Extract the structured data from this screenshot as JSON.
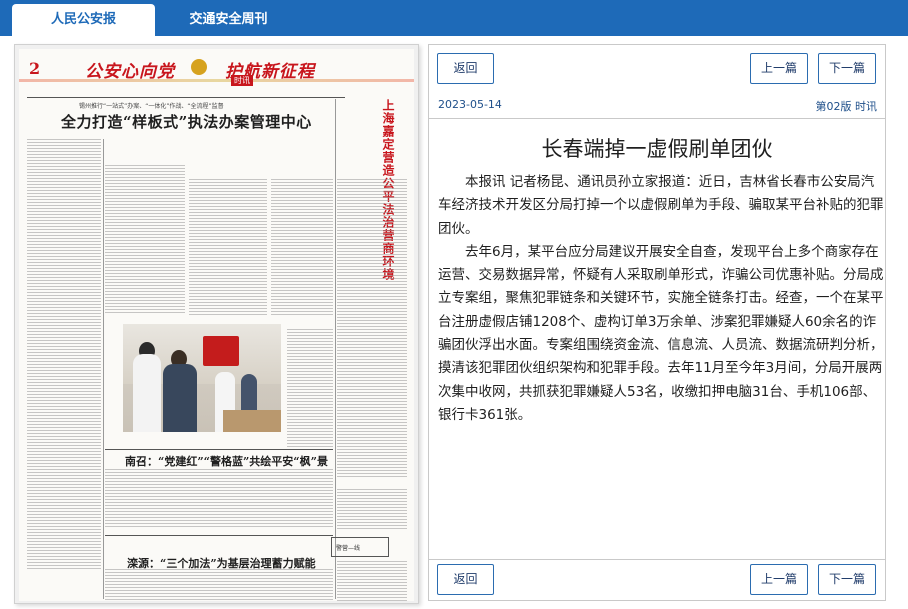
{
  "tabs": [
    {
      "label": "人民公安报",
      "active": true
    },
    {
      "label": "交通安全周刊",
      "active": false
    }
  ],
  "newspaper": {
    "page_number": "2",
    "slogan_left": "公安心向党",
    "slogan_right": "护航新征程",
    "section": "时讯",
    "headline_kicker": "锡州推行“一站式”办案、“一体化”作战、“全流程”监督",
    "headline": "全力打造“样板式”执法办案管理中心",
    "vertical_headline": "上海嘉定营造公平法治营商环境",
    "subhead_1": "南召：“党建红”“警格蓝”共绘平安“枫”景",
    "subhead_2": "滦源：“三个加法”为基层治理蓄力赋能",
    "box_label": "警营—线"
  },
  "article": {
    "back_label": "返回",
    "prev_label": "上一篇",
    "next_label": "下一篇",
    "date": "2023-05-14",
    "edition": "第02版 时讯",
    "title": "长春端掉一虚假刷单团伙",
    "paragraphs": [
      "本报讯 记者杨昆、通讯员孙立家报道：近日，吉林省长春市公安局汽车经济技术开发区分局打掉一个以虚假刷单为手段、骗取某平台补贴的犯罪团伙。",
      "去年6月，某平台应分局建议开展安全自查，发现平台上多个商家存在运营、交易数据异常，怀疑有人采取刷单形式，诈骗公司优惠补贴。分局成立专案组，聚焦犯罪链条和关键环节，实施全链条打击。经查，一个在某平台注册虚假店铺1208个、虚构订单3万余单、涉案犯罪嫌疑人60余名的诈骗团伙浮出水面。专案组围绕资金流、信息流、人员流、数据流研判分析，摸清该犯罪团伙组织架构和犯罪手段。去年11月至今年3月间，分局开展两次集中收网，共抓获犯罪嫌疑人53名，收缴扣押电脑31台、手机106部、银行卡361张。"
    ]
  },
  "colors": {
    "tabbar": "#1e6ab8",
    "accent_text": "#1e4f8a",
    "masthead_red": "#c8161d"
  }
}
